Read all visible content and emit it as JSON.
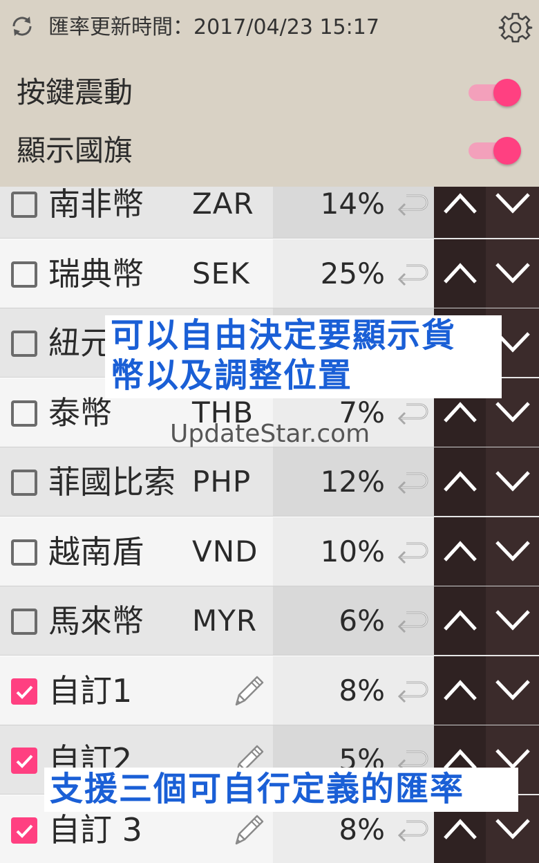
{
  "header": {
    "update_label": "匯率更新時間：2017/04/23 15:17",
    "settings": [
      {
        "label": "按鍵震動",
        "enabled": true
      },
      {
        "label": "顯示國旗",
        "enabled": true
      }
    ]
  },
  "rows": [
    {
      "name": "南非幣",
      "code": "ZAR",
      "percent": "14%",
      "checked": false
    },
    {
      "name": "瑞典幣",
      "code": "SEK",
      "percent": "25%",
      "checked": false
    },
    {
      "name": "紐元",
      "code": "",
      "percent": "",
      "checked": false
    },
    {
      "name": "泰幣",
      "code": "THB",
      "percent": "7%",
      "checked": false
    },
    {
      "name": "菲國比索",
      "code": "PHP",
      "percent": "12%",
      "checked": false
    },
    {
      "name": "越南盾",
      "code": "VND",
      "percent": "10%",
      "checked": false
    },
    {
      "name": "馬來幣",
      "code": "MYR",
      "percent": "6%",
      "checked": false
    },
    {
      "name": "自訂1",
      "code": "",
      "percent": "8%",
      "checked": true,
      "editable": true
    },
    {
      "name": "自訂2",
      "code": "",
      "percent": "5%",
      "checked": true,
      "editable": true
    },
    {
      "name": "自訂 3",
      "code": "",
      "percent": "8%",
      "checked": true,
      "editable": true
    }
  ],
  "overlays": {
    "caption_top_line1": "可以自由決定要顯示貨",
    "caption_top_line2": "幣以及調整位置",
    "caption_bottom": "支援三個可自行定義的匯率",
    "watermark": "UpdateStar.com"
  },
  "colors": {
    "header_bg": "#d9d2c5",
    "accent": "#ff4081",
    "toggle_track": "#f3a0bb",
    "arrow_column": "#2f2222",
    "caption_text": "#1a5fd6"
  },
  "icons": {
    "refresh": "refresh-icon",
    "settings": "gear-icon",
    "undo": "undo-icon",
    "move_up": "chevron-up-icon",
    "move_down": "chevron-down-icon",
    "edit": "pencil-icon"
  }
}
